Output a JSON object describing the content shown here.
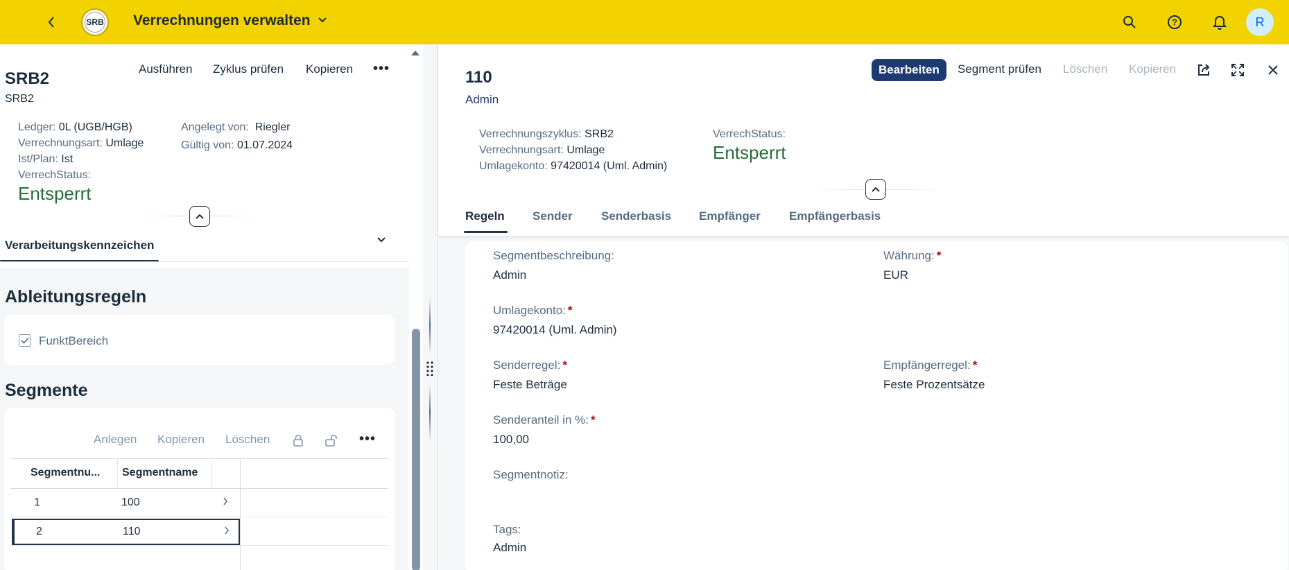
{
  "shell": {
    "title": "Verrechnungen verwalten",
    "logo_text": "SRB",
    "avatar_initial": "R"
  },
  "left": {
    "title": "SRB2",
    "subtitle": "SRB2",
    "actions": {
      "run": "Ausführen",
      "check_cycle": "Zyklus prüfen",
      "copy": "Kopieren",
      "more": "•••"
    },
    "attrs": {
      "ledger_label": "Ledger:",
      "ledger_value": "0L (UGB/HGB)",
      "type_label": "Verrechnungsart:",
      "type_value": "Umlage",
      "actplan_label": "Ist/Plan:",
      "actplan_value": "Ist",
      "status_label": "VerrechStatus:",
      "status_value": "Entsperrt",
      "created_label": "Angelegt von:",
      "created_value": "Riegler",
      "valid_label": "Gültig von:",
      "valid_value": "01.07.2024"
    },
    "section_tab": "Verarbeitungskennzeichen",
    "derivation": {
      "title": "Ableitungsregeln",
      "checkbox_label": "FunktBereich"
    },
    "segments": {
      "title": "Segmente",
      "toolbar": {
        "create": "Anlegen",
        "copy": "Kopieren",
        "delete": "Löschen"
      },
      "columns": [
        "Segmentnu...",
        "Segmentname"
      ],
      "rows": [
        {
          "number": "1",
          "name": "100"
        },
        {
          "number": "2",
          "name": "110"
        }
      ]
    }
  },
  "right": {
    "title": "110",
    "subtitle": "Admin",
    "actions": {
      "edit": "Bearbeiten",
      "check_segment": "Segment prüfen",
      "delete": "Löschen",
      "copy": "Kopieren"
    },
    "attrs": {
      "cycle_label": "Verrechnungszyklus:",
      "cycle_value": "SRB2",
      "type_label": "Verrechnungsart:",
      "type_value": "Umlage",
      "account_label": "Umlagekonto:",
      "account_value": "97420014 (Uml. Admin)",
      "status_label": "VerrechStatus:",
      "status_value": "Entsperrt"
    },
    "tabs": [
      "Regeln",
      "Sender",
      "Senderbasis",
      "Empfänger",
      "Empfängerbasis"
    ],
    "fields": {
      "segment_desc_label": "Segmentbeschreibung:",
      "segment_desc_value": "Admin",
      "currency_label": "Währung:",
      "currency_value": "EUR",
      "account_label": "Umlagekonto:",
      "account_value": "97420014 (Uml. Admin)",
      "sender_rule_label": "Senderregel:",
      "sender_rule_value": "Feste Beträge",
      "receiver_rule_label": "Empfängerregel:",
      "receiver_rule_value": "Feste Prozentsätze",
      "sender_share_label": "Senderanteil in %:",
      "sender_share_value": "100,00",
      "note_label": "Segmentnotiz:",
      "tags_label": "Tags:",
      "tags_value": "Admin",
      "required_marker": "*"
    }
  },
  "colors": {
    "shell": "#f2d300",
    "status_positive": "#256f3a",
    "emphasized_button": "#1d3b72",
    "required": "#aa0808"
  }
}
